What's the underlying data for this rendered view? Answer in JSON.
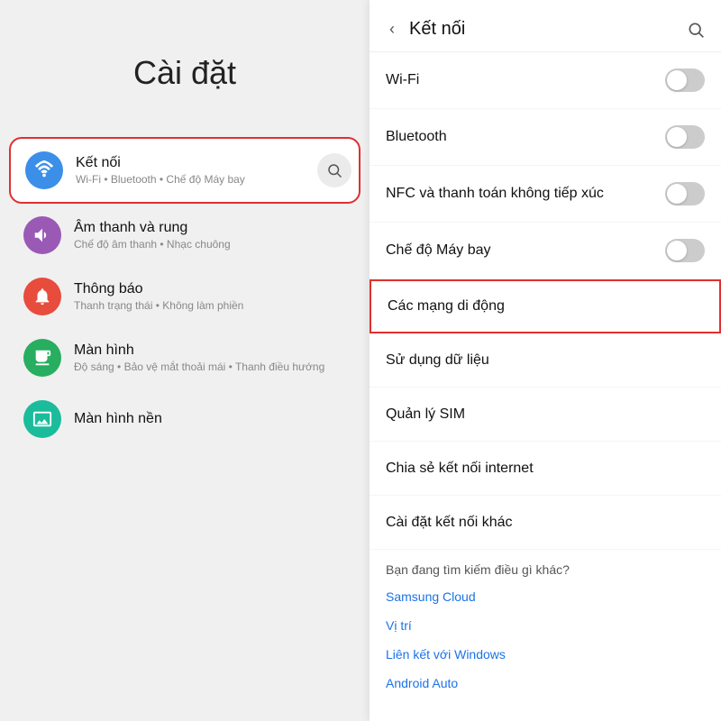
{
  "left": {
    "title": "Cài đặt",
    "items": [
      {
        "id": "ket-noi",
        "icon_color": "blue",
        "icon_type": "wifi",
        "title": "Kết nối",
        "subtitle": "Wi-Fi • Bluetooth • Chế độ Máy bay",
        "highlighted": true
      },
      {
        "id": "am-thanh",
        "icon_color": "purple",
        "icon_type": "sound",
        "title": "Âm thanh và rung",
        "subtitle": "Chế độ âm thanh • Nhạc chuông",
        "highlighted": false
      },
      {
        "id": "thong-bao",
        "icon_color": "red",
        "icon_type": "notif",
        "title": "Thông báo",
        "subtitle": "Thanh trạng thái • Không làm phiền",
        "highlighted": false
      },
      {
        "id": "man-hinh",
        "icon_color": "green",
        "icon_type": "display",
        "title": "Màn hình",
        "subtitle": "Độ sáng • Bảo vệ mắt thoải mái • Thanh điều hướng",
        "highlighted": false
      },
      {
        "id": "man-hinh-nen",
        "icon_color": "teal",
        "icon_type": "wallpaper",
        "title": "Màn hình nền",
        "subtitle": "",
        "highlighted": false
      }
    ]
  },
  "right": {
    "header": {
      "back_label": "‹",
      "title": "Kết nối",
      "search_label": "🔍"
    },
    "menu_items": [
      {
        "id": "wifi",
        "label": "Wi-Fi",
        "has_toggle": true
      },
      {
        "id": "bluetooth",
        "label": "Bluetooth",
        "has_toggle": true
      },
      {
        "id": "nfc",
        "label": "NFC và thanh toán không tiếp xúc",
        "has_toggle": true
      },
      {
        "id": "may-bay",
        "label": "Chế độ Máy bay",
        "has_toggle": true
      },
      {
        "id": "mang-di-dong",
        "label": "Các mạng di động",
        "has_toggle": false,
        "highlighted": true
      },
      {
        "id": "su-dung-du-lieu",
        "label": "Sử dụng dữ liệu",
        "has_toggle": false
      },
      {
        "id": "quan-ly-sim",
        "label": "Quản lý SIM",
        "has_toggle": false
      },
      {
        "id": "chia-se-ket-noi",
        "label": "Chia sẻ kết nối internet",
        "has_toggle": false
      },
      {
        "id": "cai-dat-ket-noi",
        "label": "Cài đặt kết nối khác",
        "has_toggle": false
      }
    ],
    "suggestions_label": "Bạn đang tìm kiếm điều gì khác?",
    "links": [
      {
        "id": "samsung-cloud",
        "label": "Samsung Cloud"
      },
      {
        "id": "vi-tri",
        "label": "Vị trí"
      },
      {
        "id": "lien-ket-windows",
        "label": "Liên kết với Windows"
      },
      {
        "id": "android-auto",
        "label": "Android Auto"
      }
    ]
  }
}
